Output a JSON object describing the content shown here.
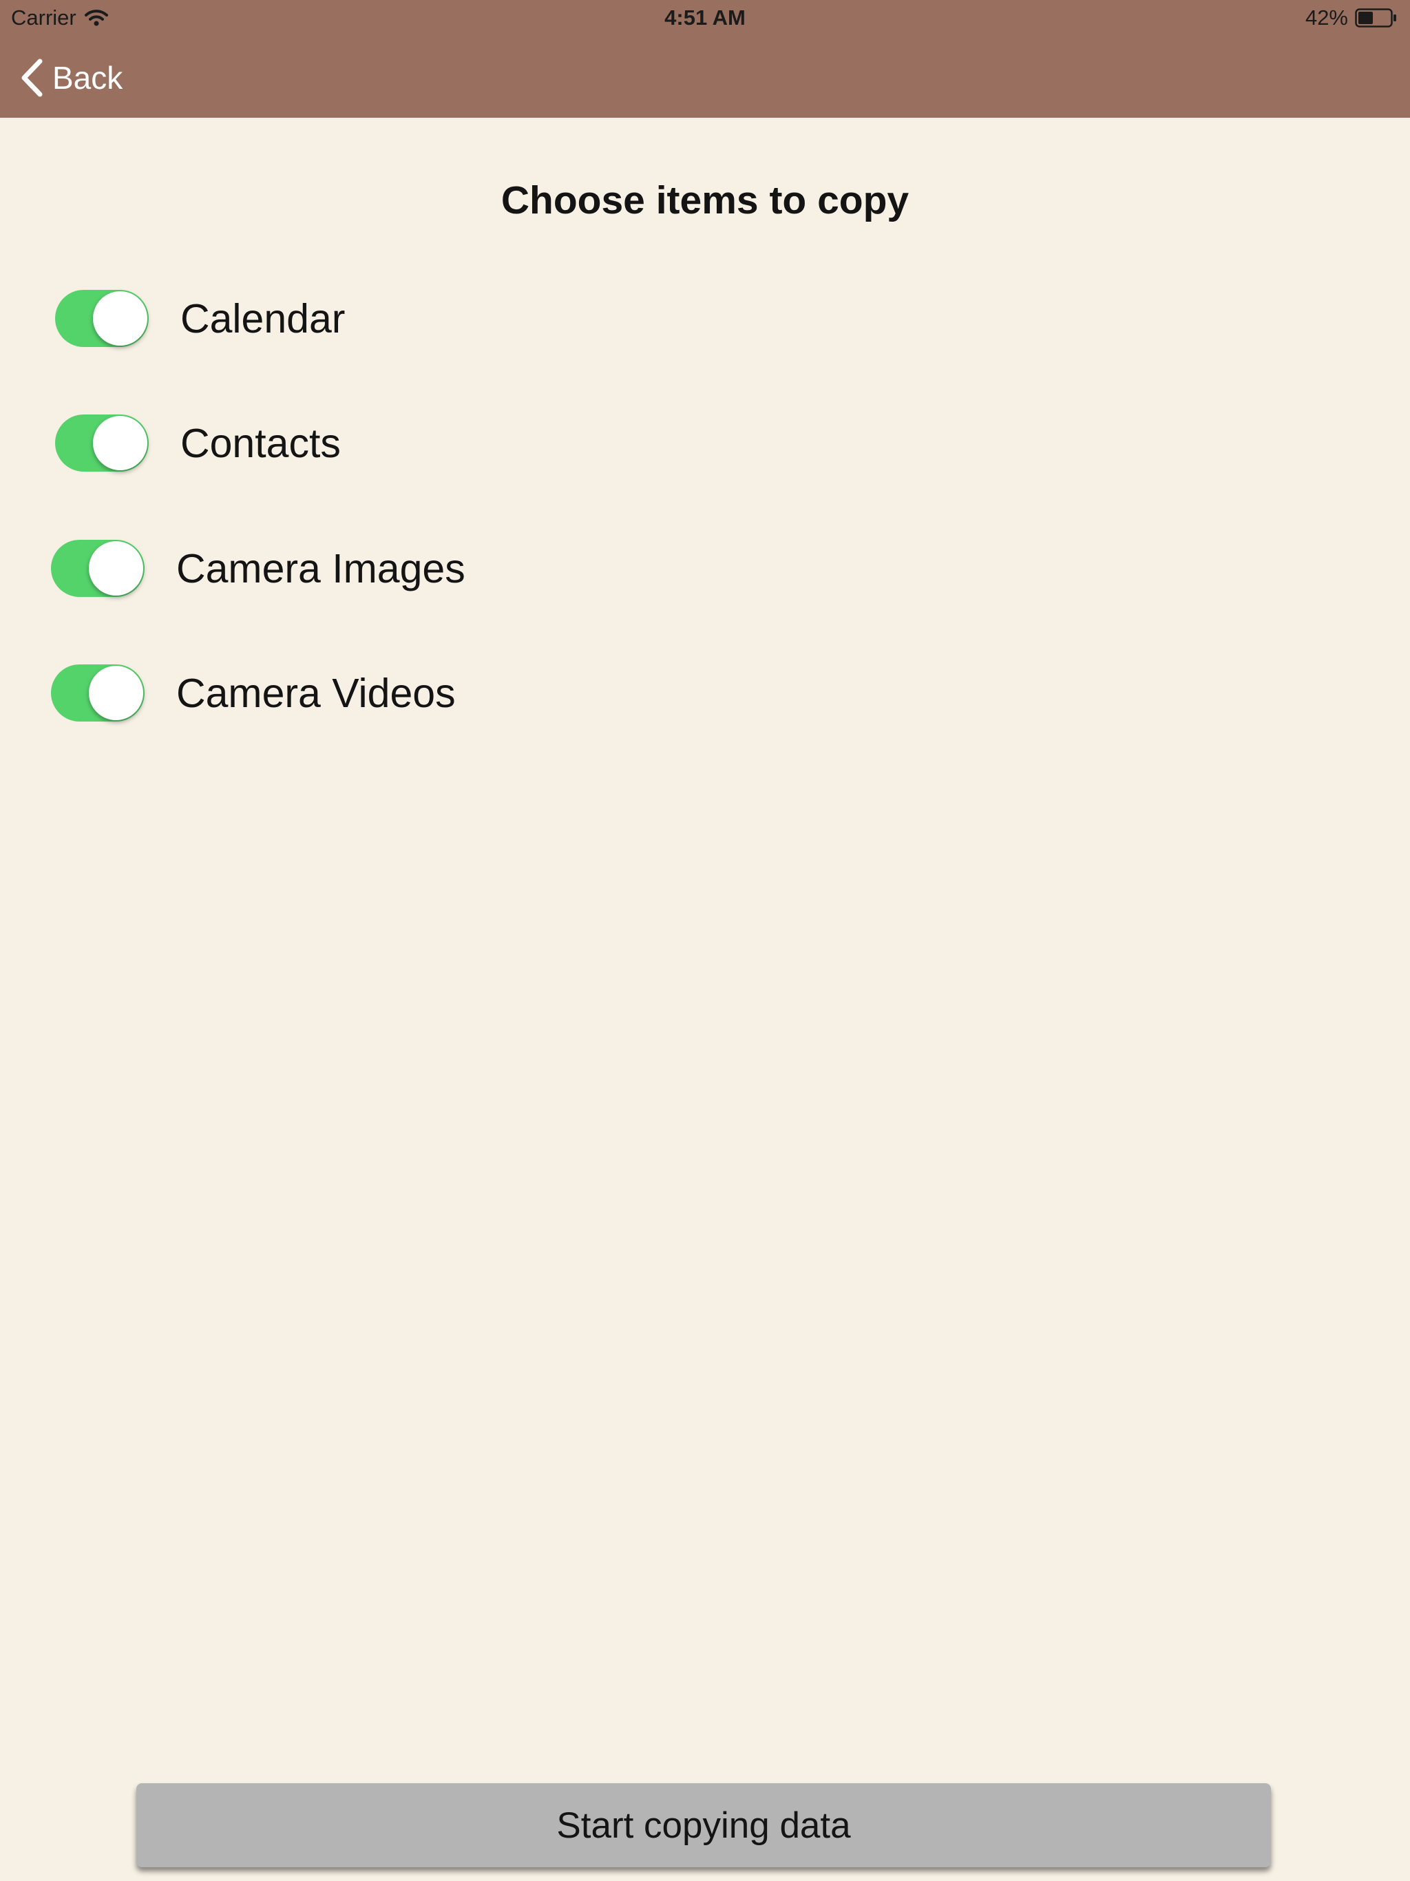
{
  "status_bar": {
    "carrier": "Carrier",
    "time": "4:51 AM",
    "battery": "42%"
  },
  "nav": {
    "back_label": "Back"
  },
  "title": "Choose items to copy",
  "items": [
    {
      "label": "Calendar",
      "on": true
    },
    {
      "label": "Contacts",
      "on": true
    },
    {
      "label": "Camera Images",
      "on": true
    },
    {
      "label": "Camera Videos",
      "on": true
    }
  ],
  "action_button": "Start copying data",
  "colors": {
    "nav_bar": "#99705f",
    "background": "#f7f1e5",
    "toggle_on": "#55d36b",
    "button": "#b4b4b4"
  }
}
